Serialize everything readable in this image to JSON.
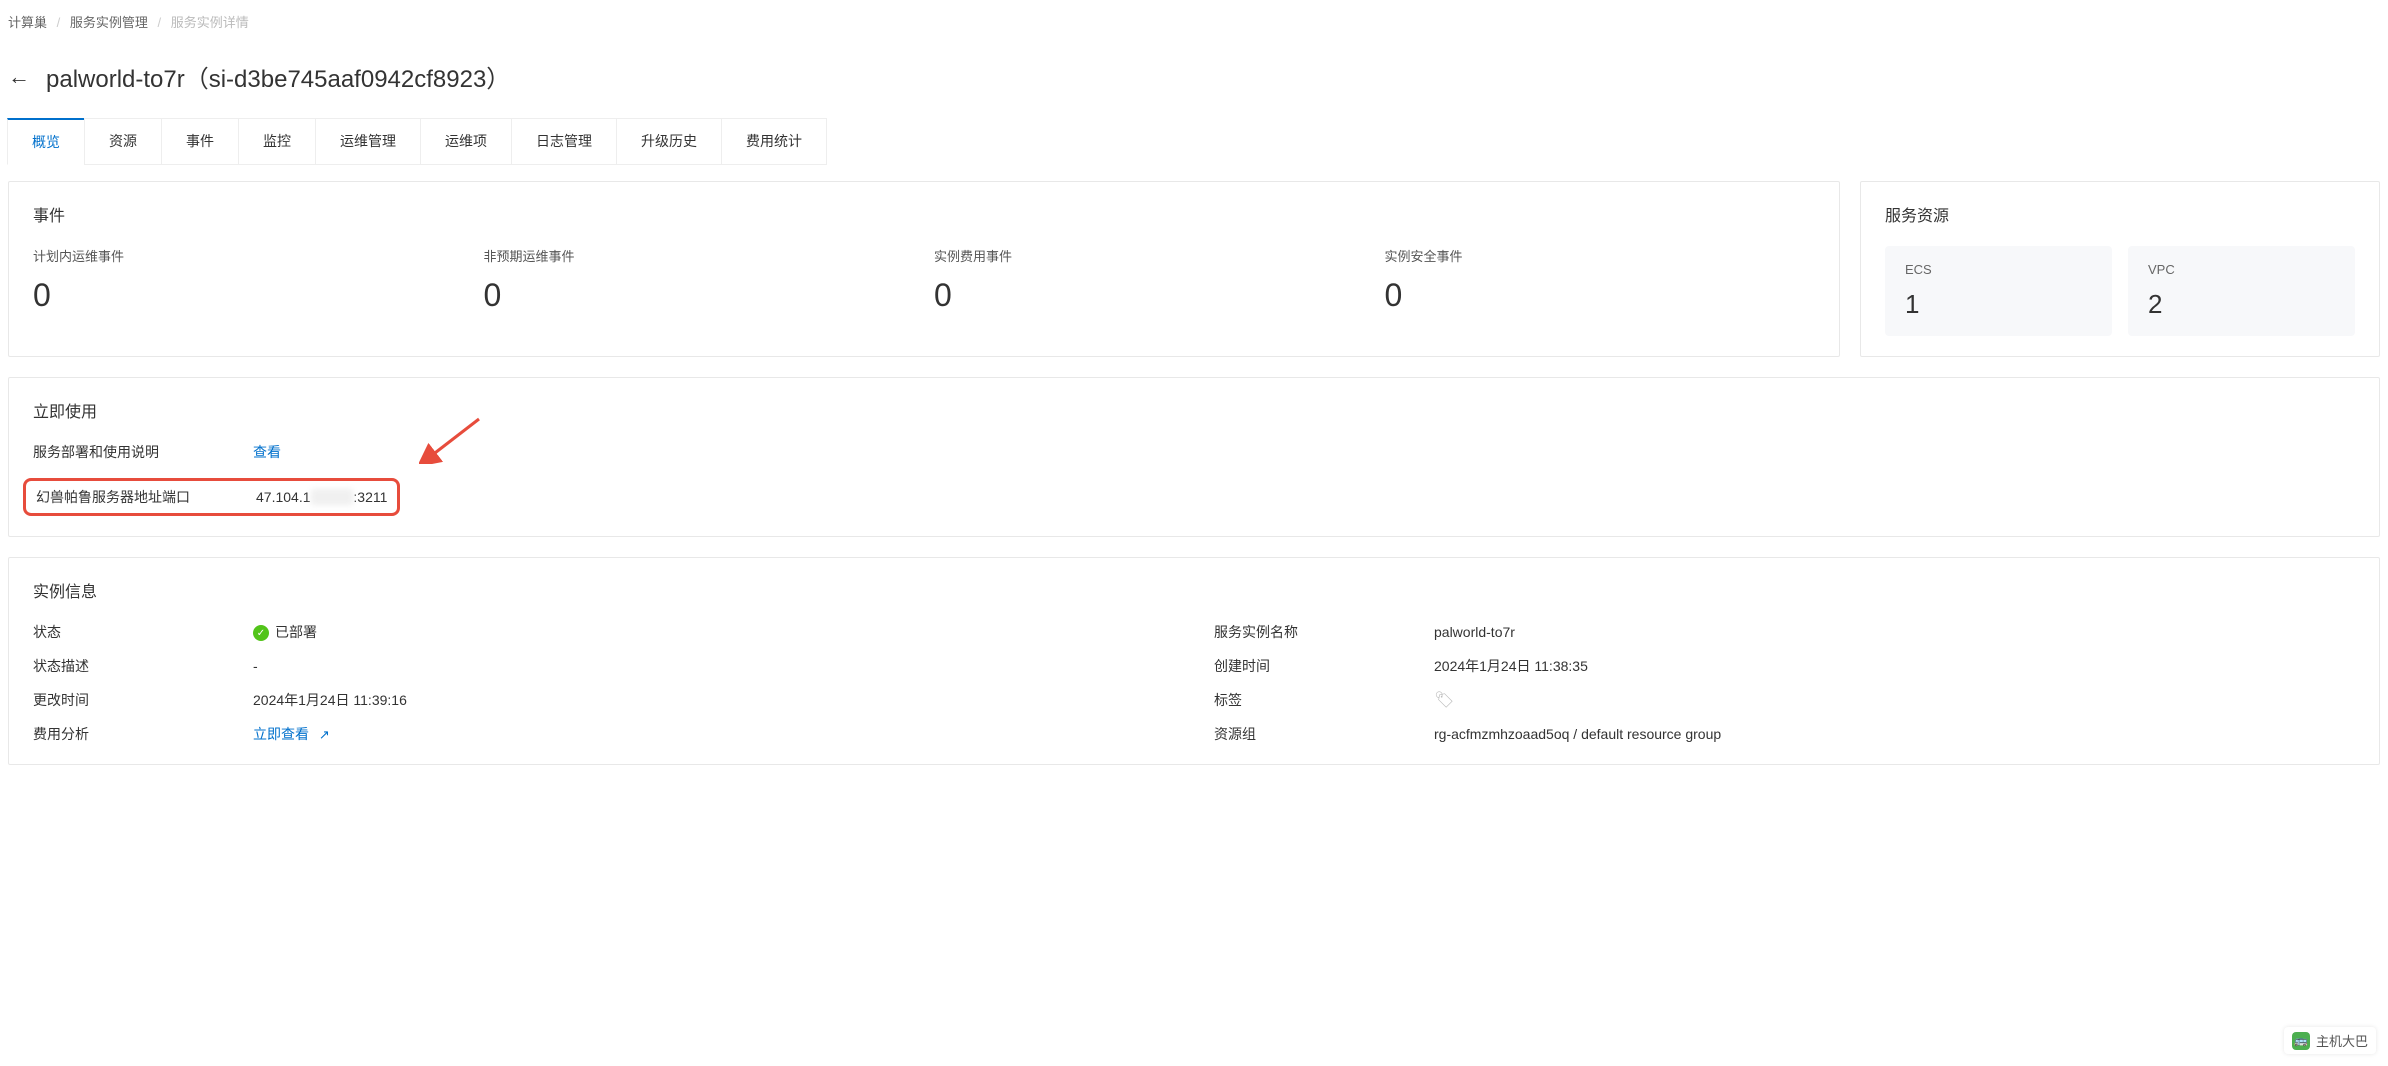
{
  "breadcrumb": {
    "root": "计算巢",
    "mid": "服务实例管理",
    "current": "服务实例详情"
  },
  "header": {
    "title": "palworld-to7r（si-d3be745aaf0942cf8923）"
  },
  "tabs": [
    {
      "label": "概览",
      "active": true
    },
    {
      "label": "资源",
      "active": false
    },
    {
      "label": "事件",
      "active": false
    },
    {
      "label": "监控",
      "active": false
    },
    {
      "label": "运维管理",
      "active": false
    },
    {
      "label": "运维项",
      "active": false
    },
    {
      "label": "日志管理",
      "active": false
    },
    {
      "label": "升级历史",
      "active": false
    },
    {
      "label": "费用统计",
      "active": false
    }
  ],
  "events": {
    "title": "事件",
    "items": [
      {
        "label": "计划内运维事件",
        "value": "0"
      },
      {
        "label": "非预期运维事件",
        "value": "0"
      },
      {
        "label": "实例费用事件",
        "value": "0"
      },
      {
        "label": "实例安全事件",
        "value": "0"
      }
    ]
  },
  "resources": {
    "title": "服务资源",
    "items": [
      {
        "label": "ECS",
        "value": "1"
      },
      {
        "label": "VPC",
        "value": "2"
      }
    ]
  },
  "usage": {
    "title": "立即使用",
    "deploy_doc_label": "服务部署和使用说明",
    "deploy_doc_link": "查看",
    "server_addr_label": "幻兽帕鲁服务器地址端口",
    "server_addr_value_prefix": "47.104.1",
    "server_addr_value_hidden": "xx.xxx",
    "server_addr_value_suffix": ":3211"
  },
  "instance": {
    "title": "实例信息",
    "status_label": "状态",
    "status_value": "已部署",
    "status_desc_label": "状态描述",
    "status_desc_value": "-",
    "update_time_label": "更改时间",
    "update_time_value": "2024年1月24日 11:39:16",
    "cost_label": "费用分析",
    "cost_link": "立即查看",
    "name_label": "服务实例名称",
    "name_value": "palworld-to7r",
    "create_time_label": "创建时间",
    "create_time_value": "2024年1月24日 11:38:35",
    "tags_label": "标签",
    "resource_group_label": "资源组",
    "resource_group_value": "rg-acfmzmhzoaad5oq / default resource group"
  },
  "watermark": {
    "text": "主机大巴"
  }
}
